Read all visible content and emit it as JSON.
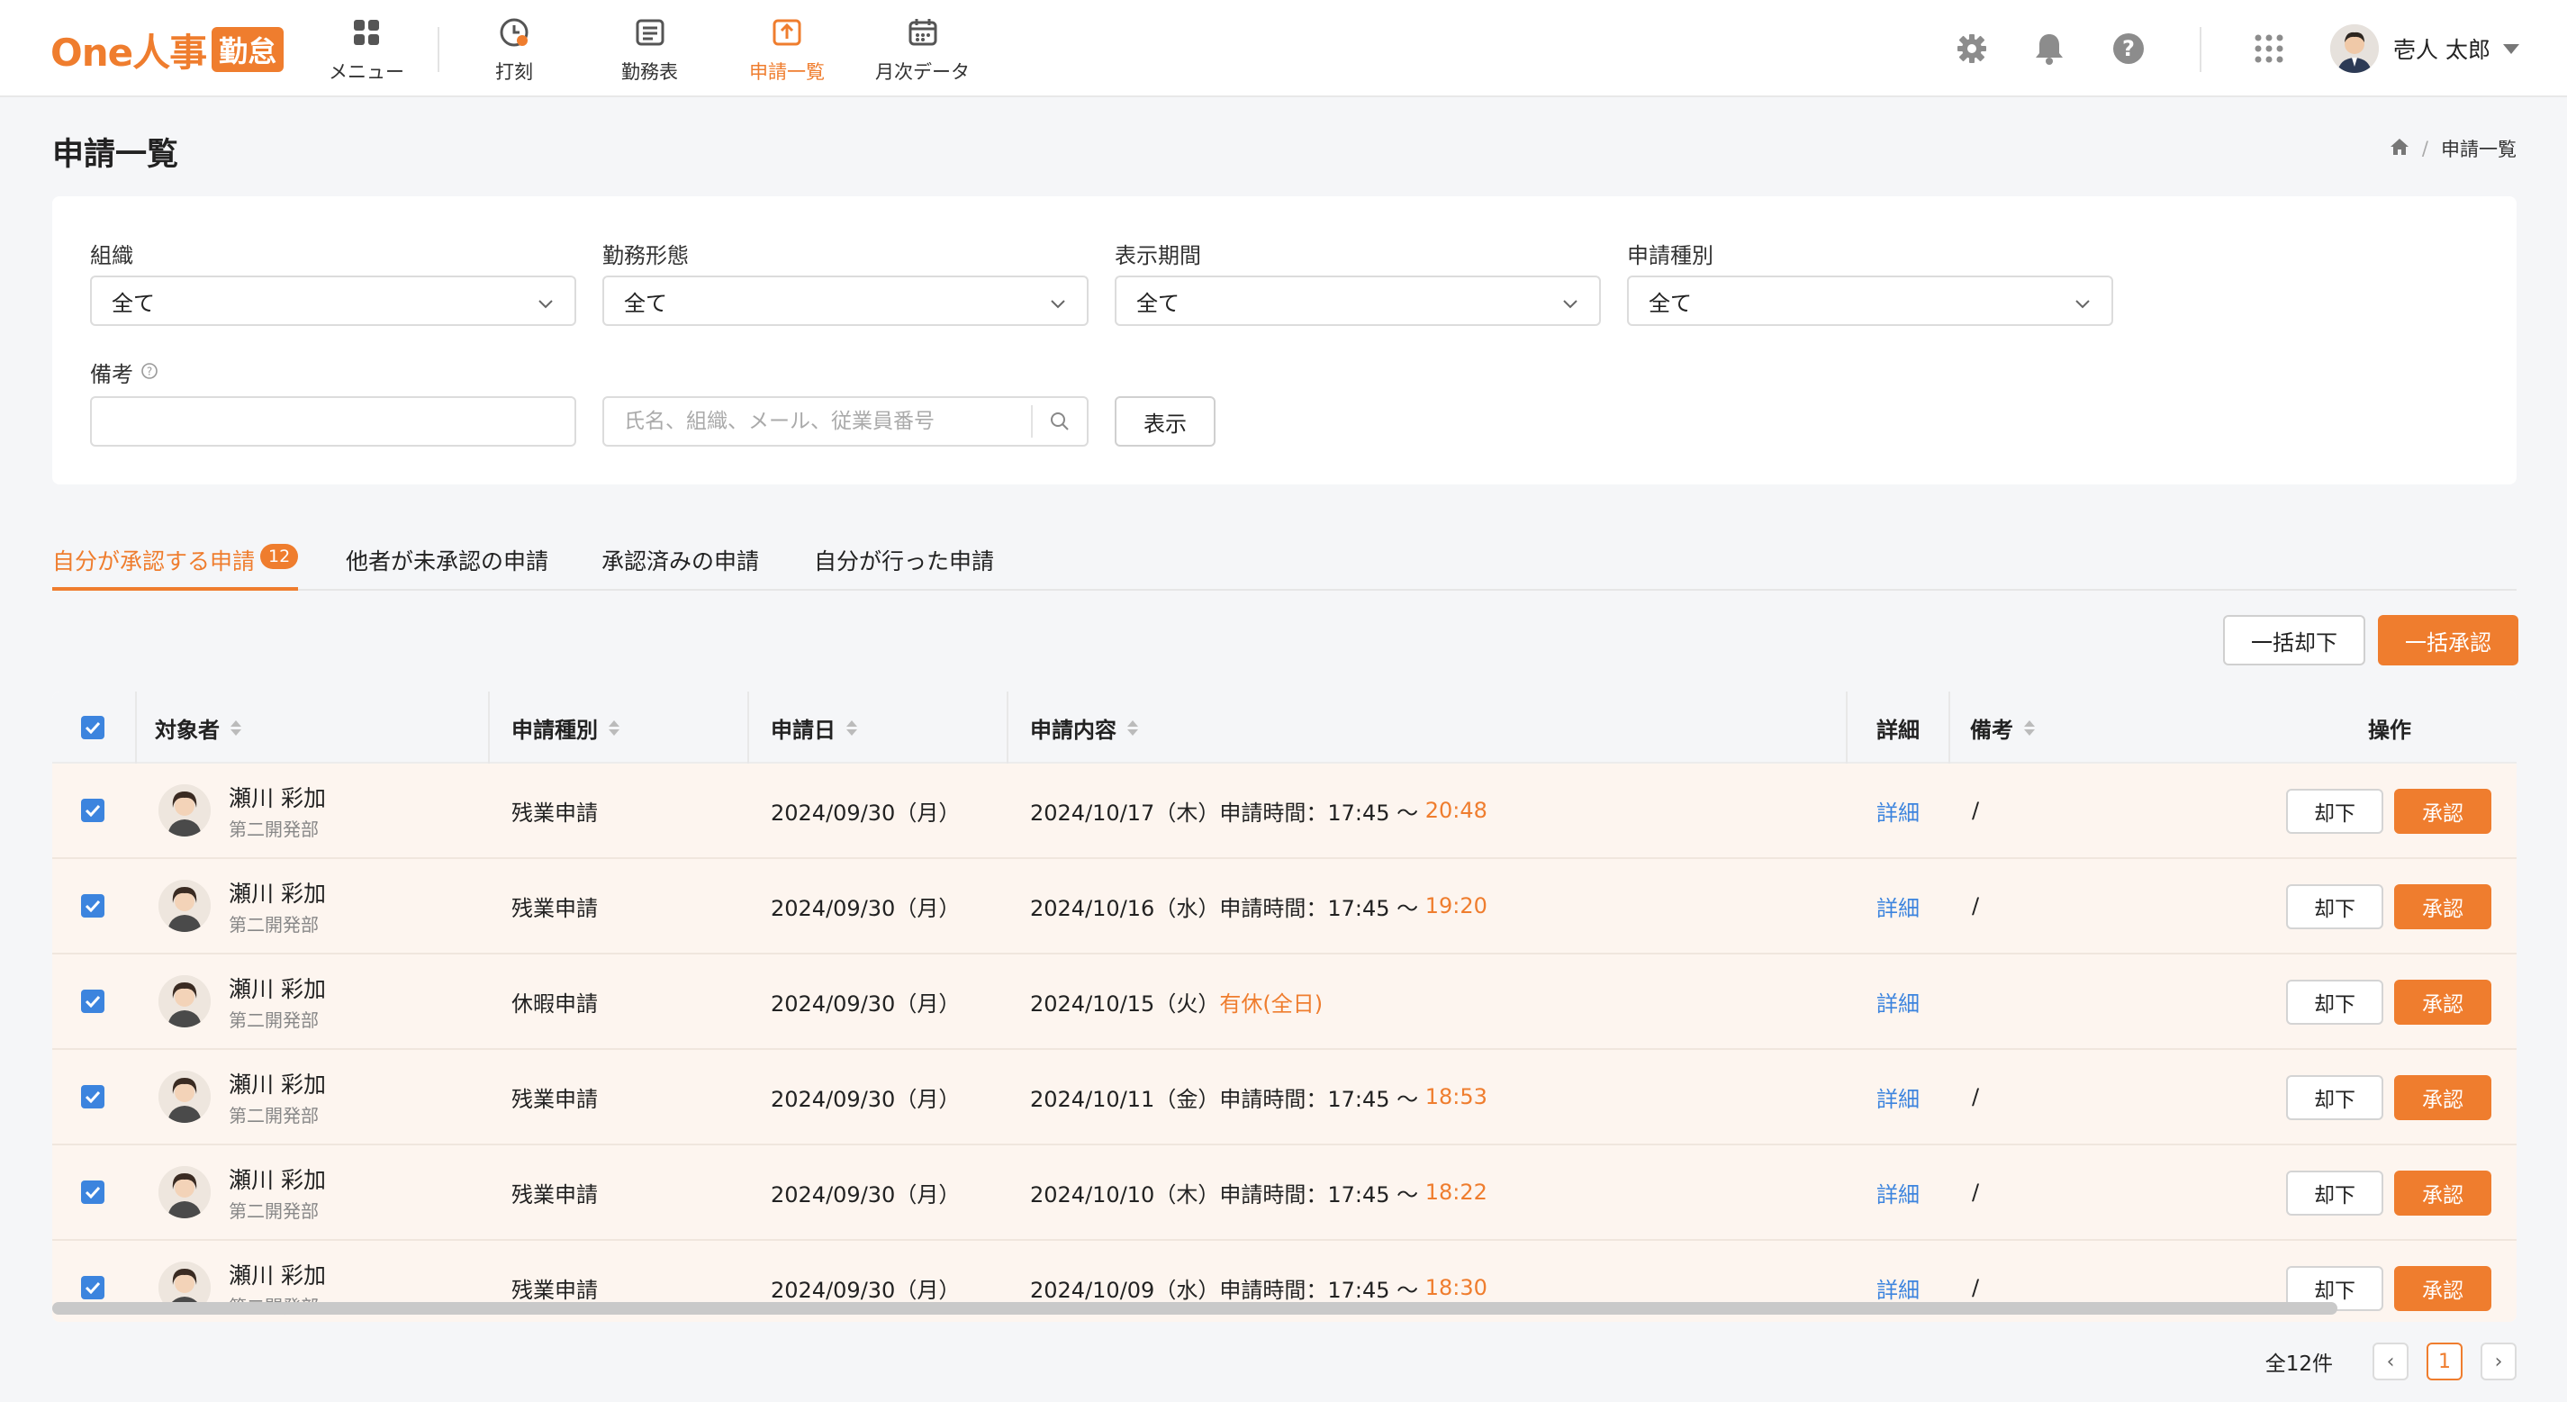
{
  "brand": {
    "logo_text": "One人事",
    "logo_badge": "勤怠",
    "accent_color": "#ef7d2e",
    "link_color": "#3c84de"
  },
  "nav": [
    {
      "label": "メニュー",
      "icon": "grid-icon"
    },
    {
      "label": "打刻",
      "icon": "clock-icon"
    },
    {
      "label": "勤務表",
      "icon": "timesheet-icon"
    },
    {
      "label": "申請一覧",
      "icon": "application-list-icon",
      "active": true
    },
    {
      "label": "月次データ",
      "icon": "calendar-icon"
    }
  ],
  "header_icons": [
    "gear-icon",
    "bell-icon",
    "help-icon",
    "apps-grid-icon"
  ],
  "user": {
    "name": "壱人 太郎"
  },
  "page": {
    "title": "申請一覧",
    "breadcrumb_current": "申請一覧"
  },
  "filters": {
    "org_label": "組織",
    "org_value": "全て",
    "work_style_label": "勤務形態",
    "work_style_value": "全て",
    "period_label": "表示期間",
    "period_value": "全て",
    "type_label": "申請種別",
    "type_value": "全て",
    "note_label": "備考",
    "note_value": "",
    "search_placeholder": "氏名、組織、メール、従業員番号",
    "show_button": "表示"
  },
  "tabs": [
    {
      "label": "自分が承認する申請",
      "count": "12",
      "active": true
    },
    {
      "label": "他者が未承認の申請"
    },
    {
      "label": "承認済みの申請"
    },
    {
      "label": "自分が行った申請"
    }
  ],
  "bulk_actions": {
    "reject_all": "一括却下",
    "approve_all": "一括承認"
  },
  "table": {
    "columns": {
      "target": "対象者",
      "type": "申請種別",
      "date": "申請日",
      "content": "申請内容",
      "detail": "詳細",
      "note": "備考",
      "action": "操作"
    },
    "rows": [
      {
        "name": "瀬川 彩加",
        "dept": "第二開発部",
        "type": "残業申請",
        "date": "2024/09/30（月）",
        "content": "2024/10/17（木）申請時間：17:45 〜 ",
        "content_hl": "20:48",
        "detail": "詳細",
        "note": "/",
        "reject": "却下",
        "approve": "承認"
      },
      {
        "name": "瀬川 彩加",
        "dept": "第二開発部",
        "type": "残業申請",
        "date": "2024/09/30（月）",
        "content": "2024/10/16（水）申請時間：17:45 〜 ",
        "content_hl": "19:20",
        "detail": "詳細",
        "note": "/",
        "reject": "却下",
        "approve": "承認"
      },
      {
        "name": "瀬川 彩加",
        "dept": "第二開発部",
        "type": "休暇申請",
        "date": "2024/09/30（月）",
        "content": "2024/10/15（火）",
        "content_hl": "有休(全日)",
        "detail": "詳細",
        "note": "",
        "reject": "却下",
        "approve": "承認"
      },
      {
        "name": "瀬川 彩加",
        "dept": "第二開発部",
        "type": "残業申請",
        "date": "2024/09/30（月）",
        "content": "2024/10/11（金）申請時間：17:45 〜 ",
        "content_hl": "18:53",
        "detail": "詳細",
        "note": "/",
        "reject": "却下",
        "approve": "承認"
      },
      {
        "name": "瀬川 彩加",
        "dept": "第二開発部",
        "type": "残業申請",
        "date": "2024/09/30（月）",
        "content": "2024/10/10（木）申請時間：17:45 〜 ",
        "content_hl": "18:22",
        "detail": "詳細",
        "note": "/",
        "reject": "却下",
        "approve": "承認"
      },
      {
        "name": "瀬川 彩加",
        "dept": "第二開発部",
        "type": "残業申請",
        "date": "2024/09/30（月）",
        "content": "2024/10/09（水）申請時間：17:45 〜 ",
        "content_hl": "18:30",
        "detail": "詳細",
        "note": "/",
        "reject": "却下",
        "approve": "承認"
      }
    ]
  },
  "pagination": {
    "total": "全12件",
    "current_page": "1",
    "prev": "‹",
    "next": "›"
  }
}
